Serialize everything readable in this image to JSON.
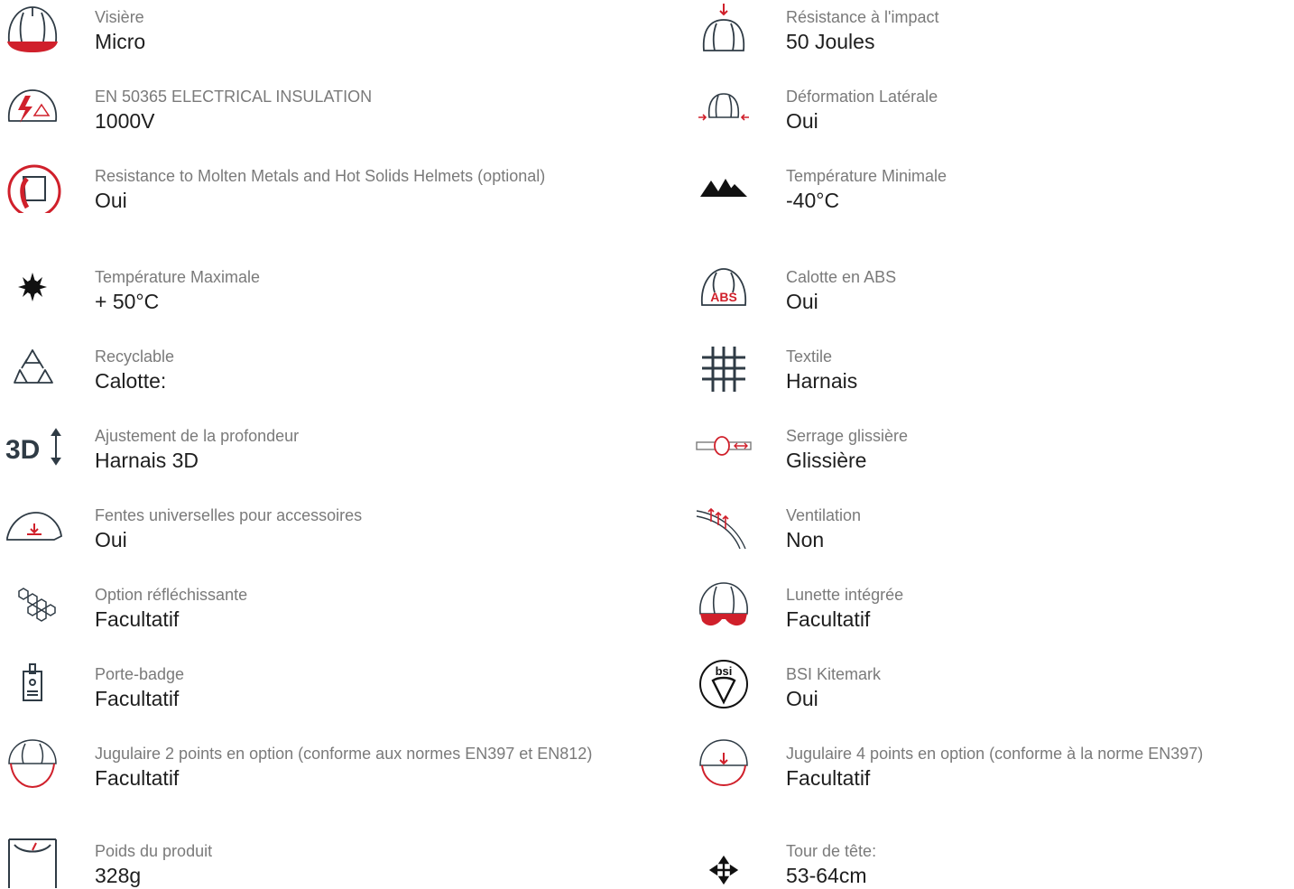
{
  "colors": {
    "label": "#7a7a7a",
    "value": "#1e1e1e",
    "icon_outline": "#2f3b45",
    "icon_accent": "#d0202b"
  },
  "left_column": [
    {
      "icon": "visor-helmet-icon",
      "label": "Visière",
      "value": "Micro"
    },
    {
      "icon": "electrical-insulation-icon",
      "label": "EN 50365 ELECTRICAL INSULATION",
      "value": "1000V"
    },
    {
      "icon": "molten-metal-icon",
      "label": "Resistance to Molten Metals and Hot Solids Helmets (optional)",
      "value": "Oui"
    },
    {
      "icon": "sun-icon",
      "label": "Température Maximale",
      "value": "+ 50°C"
    },
    {
      "icon": "recycle-icon",
      "label": "Recyclable",
      "value": "Calotte:"
    },
    {
      "icon": "depth-3d-icon",
      "label": "Ajustement de la profondeur",
      "value": "Harnais 3D"
    },
    {
      "icon": "accessory-slot-icon",
      "label": "Fentes universelles pour accessoires",
      "value": "Oui"
    },
    {
      "icon": "reflective-hexagon-icon",
      "label": "Option réfléchissante",
      "value": "Facultatif"
    },
    {
      "icon": "badge-holder-icon",
      "label": "Porte-badge",
      "value": "Facultatif"
    },
    {
      "icon": "chinstrap-2pt-icon",
      "label": "Jugulaire 2 points en option (conforme aux normes EN397 et EN812)",
      "value": "Facultatif"
    },
    {
      "icon": "weight-scale-icon",
      "label": "Poids du produit",
      "value": "328g"
    }
  ],
  "right_column": [
    {
      "icon": "impact-helmet-icon",
      "label": "Résistance à l'impact",
      "value": "50 Joules"
    },
    {
      "icon": "lateral-deformation-icon",
      "label": "Déformation Latérale",
      "value": "Oui"
    },
    {
      "icon": "mountains-icon",
      "label": "Température Minimale",
      "value": "-40°C"
    },
    {
      "icon": "abs-shell-icon",
      "label": "Calotte en ABS",
      "value": "Oui"
    },
    {
      "icon": "textile-weave-icon",
      "label": "Textile",
      "value": "Harnais"
    },
    {
      "icon": "slide-adjust-icon",
      "label": "Serrage glissière",
      "value": "Glissière"
    },
    {
      "icon": "ventilation-icon",
      "label": "Ventilation",
      "value": "Non"
    },
    {
      "icon": "integrated-eyewear-icon",
      "label": "Lunette intégrée",
      "value": "Facultatif"
    },
    {
      "icon": "bsi-kitemark-icon",
      "label": "BSI Kitemark",
      "value": "Oui"
    },
    {
      "icon": "chinstrap-4pt-icon",
      "label": "Jugulaire 4 points en option (conforme à la norme EN397)",
      "value": "Facultatif"
    },
    {
      "icon": "move-arrows-icon",
      "label": "Tour de tête:",
      "value": "53-64cm"
    }
  ],
  "icon_text": {
    "abs": "ABS",
    "bsi": "bsi",
    "depth": "3D"
  }
}
